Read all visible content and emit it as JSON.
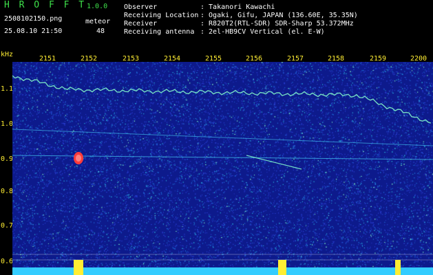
{
  "app": {
    "name": "H R O F F T",
    "version": "1.0.0"
  },
  "file": {
    "name": "2508102150.png",
    "datetime": "25.08.10 21:50"
  },
  "meteor": {
    "label": "meteor",
    "count": "48"
  },
  "info": {
    "observer": {
      "label": "Observer",
      "value": ": Takanori Kawachi"
    },
    "location": {
      "label": "Receiving Location",
      "value": ": Ogaki, Gifu, JAPAN (136.60E, 35.35N)"
    },
    "receiver": {
      "label": "Receiver",
      "value": ": R820T2(RTL-SDR) SDR-Sharp 53.372MHz"
    },
    "antenna": {
      "label": "Receiving antenna",
      "value": ": 2el-HB9CV Vertical (el. E-W)"
    }
  },
  "axis": {
    "unit": "kHz",
    "time_ticks": [
      "2151",
      "2152",
      "2153",
      "2154",
      "2155",
      "2156",
      "2157",
      "2158",
      "2159",
      "2200"
    ],
    "freq_ticks": [
      "1.1",
      "1.0",
      "0.9",
      "0.8",
      "0.7",
      "0.6"
    ]
  },
  "colors": {
    "label": "#ffee33",
    "header_green": "#3ee04a",
    "noise_bg": "#0d1a8c",
    "trace": "#7ef0c8",
    "baseline": "#33ccff"
  }
}
